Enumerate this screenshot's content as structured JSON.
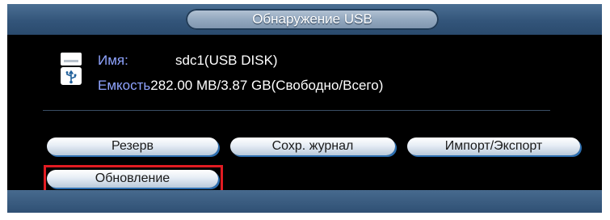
{
  "dialog": {
    "title": "Обнаружение USB"
  },
  "device": {
    "icon": "usb-drive-icon",
    "name_label": "Имя:",
    "name_value": "sdc1(USB DISK)",
    "capacity_label": "Емкость",
    "capacity_value": "282.00 MB/3.87 GB(Свободно/Всего)"
  },
  "buttons": {
    "backup": "Резерв",
    "save_log": "Сохр. журнал",
    "import_export": "Импорт/Экспорт",
    "update": "Обновление"
  },
  "colors": {
    "label_blue": "#8fa4ff",
    "highlight_red": "#e11b22",
    "bar_blue": "#33557a"
  }
}
